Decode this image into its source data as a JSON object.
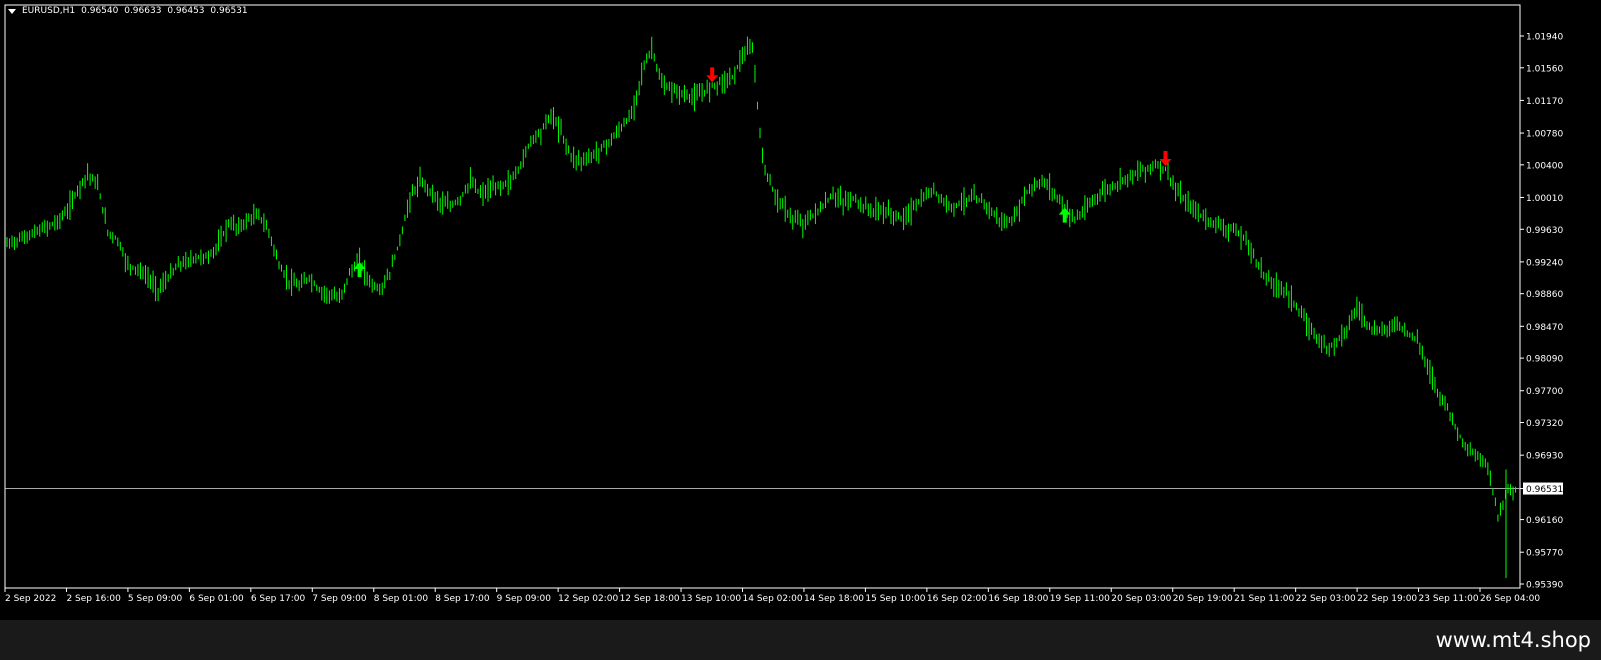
{
  "header": {
    "symbol": "EURUSD,H1",
    "open": "0.96540",
    "high": "0.96633",
    "low": "0.96453",
    "close": "0.96531"
  },
  "watermark": "www.mt4.shop",
  "colors": {
    "bg": "#000000",
    "candle": "#00ff00",
    "buy": "#00ff00",
    "sell": "#ff0000",
    "axis": "#ffffff",
    "current_line": "#c0c0c0"
  },
  "chart_data": {
    "type": "line",
    "ylim": [
      0.9539,
      1.0194
    ],
    "y_ticks": [
      "1.01940",
      "1.01560",
      "1.01170",
      "1.00780",
      "1.00400",
      "1.00010",
      "0.99630",
      "0.99240",
      "0.98860",
      "0.98470",
      "0.98090",
      "0.97700",
      "0.97320",
      "0.96930",
      "0.96531",
      "0.96160",
      "0.95770",
      "0.95390"
    ],
    "x_ticks": [
      "2 Sep 2022",
      "2 Sep 16:00",
      "5 Sep 09:00",
      "6 Sep 01:00",
      "6 Sep 17:00",
      "7 Sep 09:00",
      "8 Sep 01:00",
      "8 Sep 17:00",
      "9 Sep 09:00",
      "12 Sep 02:00",
      "12 Sep 18:00",
      "13 Sep 10:00",
      "14 Sep 02:00",
      "14 Sep 18:00",
      "15 Sep 10:00",
      "16 Sep 02:00",
      "16 Sep 18:00",
      "19 Sep 11:00",
      "20 Sep 03:00",
      "20 Sep 19:00",
      "21 Sep 11:00",
      "22 Sep 03:00",
      "22 Sep 19:00",
      "23 Sep 11:00",
      "26 Sep 04:00"
    ],
    "current_price": 0.96531,
    "series": [
      {
        "values": [
          0.9945,
          0.995,
          0.9955,
          0.996,
          0.9966,
          0.9972,
          0.9985,
          1.001,
          1.003,
          1.0015,
          0.996,
          0.995,
          0.992,
          0.9915,
          0.9905,
          0.989,
          0.9905,
          0.992,
          0.9925,
          0.993,
          0.993,
          0.9945,
          0.997,
          0.9965,
          0.9975,
          0.998,
          0.996,
          0.992,
          0.99,
          0.9895,
          0.9905,
          0.989,
          0.9885,
          0.988,
          0.991,
          0.9925,
          0.99,
          0.989,
          0.991,
          0.995,
          1.0,
          1.002,
          1.001,
          0.9995,
          0.999,
          1.0,
          1.002,
          1.0005,
          1.001,
          1.0015,
          1.002,
          1.004,
          1.007,
          1.008,
          1.01,
          1.008,
          1.005,
          1.0045,
          1.005,
          1.006,
          1.007,
          1.0085,
          1.01,
          1.015,
          1.018,
          1.0135,
          1.013,
          1.0125,
          1.012,
          1.0125,
          1.0135,
          1.014,
          1.0145,
          1.017,
          1.018,
          1.0045,
          1.001,
          0.999,
          0.9975,
          0.997,
          0.998,
          0.999,
          1.0005,
          0.9995,
          1.0,
          0.999,
          0.9985,
          0.9985,
          0.998,
          0.9975,
          0.999,
          1.0,
          1.001,
          0.9995,
          0.999,
          0.9998,
          1.0,
          0.9995,
          0.998,
          0.997,
          0.9975,
          1.0005,
          1.0015,
          1.002,
          1.0005,
          0.999,
          0.9975,
          0.9985,
          1.0,
          1.001,
          1.0015,
          1.0025,
          1.003,
          1.0035,
          1.004,
          1.0035,
          1.001,
          0.9995,
          0.9985,
          0.9975,
          0.997,
          0.9965,
          0.996,
          0.995,
          0.9925,
          0.9905,
          0.9895,
          0.989,
          0.987,
          0.985,
          0.9835,
          0.982,
          0.983,
          0.9845,
          0.987,
          0.985,
          0.984,
          0.9845,
          0.985,
          0.984,
          0.983,
          0.98,
          0.977,
          0.975,
          0.972,
          0.97,
          0.969,
          0.968,
          0.962,
          0.9653
        ]
      }
    ],
    "signals": [
      {
        "type": "buy",
        "index": 35,
        "color": "#00ff00"
      },
      {
        "type": "sell",
        "index": 70,
        "color": "#ff0000"
      },
      {
        "type": "buy",
        "index": 105,
        "color": "#00ff00"
      },
      {
        "type": "sell",
        "index": 115,
        "color": "#ff0000"
      }
    ]
  }
}
